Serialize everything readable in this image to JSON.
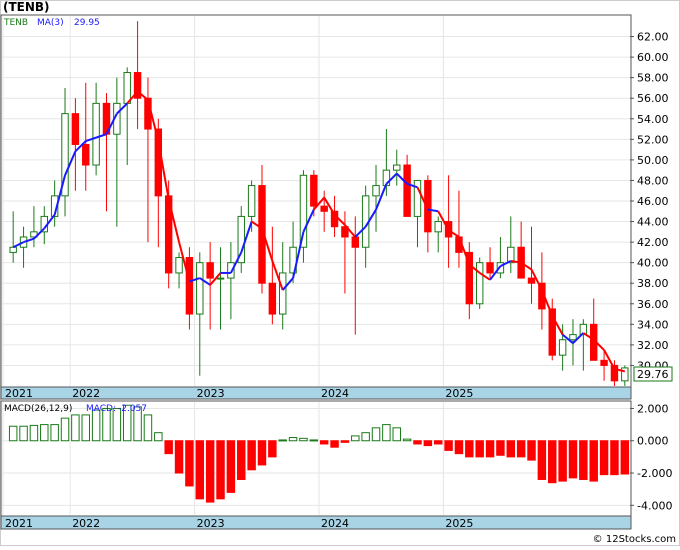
{
  "title": "(TENB)",
  "colors": {
    "up_candle": "#1a7a1a",
    "down_candle": "#ff0000",
    "ma_up": "#1a1aff",
    "ma_down": "#ff0000",
    "axis_band": "#a8d4e6",
    "last_price_box": "#1a7a1a",
    "macd_hist": "#ff0000",
    "macd_hist_pos": "#1a7a1a"
  },
  "price_panel": {
    "legend": {
      "symbol": "TENB",
      "ma_label": "MA(3)",
      "ma_value": "29.95"
    },
    "last_price": "29.76"
  },
  "macd_panel": {
    "legend": {
      "params": "MACD(26,12,9)",
      "macd_label": "MACD:",
      "macd_value": "-2.057"
    }
  },
  "x_axis_years": [
    "2021",
    "2022",
    "2023",
    "2024",
    "2025"
  ],
  "footer": "© 12Stocks.com",
  "chart_data": [
    {
      "type": "candlestick",
      "title": "(TENB)",
      "ylim": [
        28.0,
        64.0
      ],
      "y_ticks": [
        "30.00",
        "32.00",
        "34.00",
        "36.00",
        "38.00",
        "40.00",
        "42.00",
        "44.00",
        "46.00",
        "48.00",
        "50.00",
        "52.00",
        "54.00",
        "56.00",
        "58.00",
        "60.00",
        "62.00"
      ],
      "y_tick_values": [
        30,
        32,
        34,
        36,
        38,
        40,
        42,
        44,
        46,
        48,
        50,
        52,
        54,
        56,
        58,
        60,
        62
      ],
      "ohlc": [
        [
          41.0,
          45.0,
          40.0,
          41.5
        ],
        [
          41.5,
          43.5,
          39.5,
          42.5
        ],
        [
          42.5,
          45.5,
          41.5,
          43.0
        ],
        [
          43.0,
          45.5,
          41.8,
          44.5
        ],
        [
          44.5,
          48.0,
          43.5,
          46.5
        ],
        [
          46.5,
          57.0,
          44.5,
          54.5
        ],
        [
          54.5,
          56.0,
          47.0,
          51.5
        ],
        [
          51.5,
          57.5,
          47.0,
          49.5
        ],
        [
          49.5,
          57.5,
          48.5,
          55.5
        ],
        [
          55.5,
          56.5,
          45.0,
          52.5
        ],
        [
          52.5,
          58.0,
          43.5,
          55.5
        ],
        [
          55.5,
          59.0,
          49.5,
          58.5
        ],
        [
          58.5,
          63.5,
          53.0,
          56.0
        ],
        [
          56.0,
          58.0,
          42.0,
          53.0
        ],
        [
          53.0,
          54.0,
          41.5,
          46.5
        ],
        [
          46.5,
          48.0,
          37.5,
          39.0
        ],
        [
          39.0,
          41.0,
          37.5,
          40.5
        ],
        [
          40.5,
          41.5,
          33.5,
          35.0
        ],
        [
          35.0,
          41.0,
          29.0,
          40.0
        ],
        [
          40.0,
          42.0,
          33.5,
          38.5
        ],
        [
          38.5,
          41.5,
          33.5,
          38.5
        ],
        [
          38.5,
          42.0,
          34.5,
          40.0
        ],
        [
          40.0,
          45.5,
          39.0,
          44.5
        ],
        [
          44.5,
          48.0,
          43.0,
          47.5
        ],
        [
          47.5,
          49.5,
          37.0,
          38.0
        ],
        [
          38.0,
          43.5,
          34.0,
          35.0
        ],
        [
          35.0,
          42.0,
          33.5,
          39.0
        ],
        [
          39.0,
          44.0,
          38.0,
          41.5
        ],
        [
          41.5,
          49.0,
          40.0,
          48.5
        ],
        [
          48.5,
          49.0,
          44.5,
          45.5
        ],
        [
          45.5,
          47.0,
          43.0,
          45.0
        ],
        [
          45.0,
          46.5,
          42.5,
          43.5
        ],
        [
          43.5,
          45.0,
          37.0,
          42.5
        ],
        [
          42.5,
          44.5,
          33.0,
          41.5
        ],
        [
          41.5,
          47.5,
          39.5,
          46.5
        ],
        [
          46.5,
          49.5,
          43.0,
          47.5
        ],
        [
          47.5,
          53.0,
          46.5,
          49.0
        ],
        [
          49.0,
          51.0,
          47.5,
          49.5
        ],
        [
          49.5,
          50.5,
          45.0,
          44.5
        ],
        [
          44.5,
          47.0,
          41.5,
          48.0
        ],
        [
          48.0,
          48.5,
          41.0,
          43.0
        ],
        [
          43.0,
          44.5,
          41.0,
          44.0
        ],
        [
          44.0,
          48.5,
          39.5,
          42.5
        ],
        [
          42.5,
          47.0,
          39.5,
          41.0
        ],
        [
          41.0,
          42.0,
          34.5,
          36.0
        ],
        [
          36.0,
          40.5,
          35.5,
          40.0
        ],
        [
          40.0,
          41.5,
          38.5,
          39.0
        ],
        [
          39.0,
          42.5,
          38.5,
          40.0
        ],
        [
          40.0,
          44.5,
          39.0,
          41.5
        ],
        [
          41.5,
          44.0,
          38.5,
          38.5
        ],
        [
          38.5,
          43.5,
          36.0,
          38.0
        ],
        [
          38.0,
          41.0,
          33.5,
          35.5
        ],
        [
          35.5,
          36.5,
          30.5,
          31.0
        ],
        [
          31.0,
          34.0,
          29.5,
          32.5
        ],
        [
          32.5,
          34.5,
          30.0,
          33.0
        ],
        [
          33.0,
          34.5,
          29.5,
          34.0
        ],
        [
          34.0,
          36.5,
          31.0,
          30.5
        ],
        [
          30.5,
          31.5,
          28.5,
          30.0
        ],
        [
          30.0,
          30.5,
          28.0,
          28.5
        ],
        [
          28.5,
          30.0,
          28.0,
          29.76
        ]
      ],
      "ma_color_index": [
        1,
        1,
        1,
        1,
        1,
        1,
        1,
        1,
        1,
        1,
        1,
        1,
        0,
        0,
        0,
        0,
        0,
        0,
        1,
        1,
        0,
        1,
        1,
        1,
        0,
        0,
        0,
        1,
        1,
        1,
        0,
        0,
        0,
        0,
        1,
        1,
        1,
        1,
        1,
        1,
        0,
        1,
        0,
        0,
        0,
        0,
        0,
        1,
        1,
        0,
        0,
        0,
        0,
        0,
        1,
        1,
        0,
        0,
        0,
        0
      ]
    },
    {
      "type": "bar",
      "title": "MACD(26,12,9)",
      "ylim": [
        -4.6,
        2.4
      ],
      "y_ticks": [
        "2.000",
        "0.000",
        "-2.000",
        "-4.000"
      ],
      "y_tick_values": [
        2,
        0,
        -2,
        -4
      ],
      "values": [
        0.9,
        0.9,
        0.95,
        1.0,
        1.0,
        1.4,
        1.6,
        1.6,
        1.9,
        2.0,
        2.0,
        2.2,
        2.1,
        1.6,
        0.5,
        -0.8,
        -2.0,
        -2.8,
        -3.6,
        -3.8,
        -3.6,
        -3.2,
        -2.4,
        -1.8,
        -1.5,
        -1.0,
        0.05,
        0.2,
        0.15,
        0.05,
        -0.2,
        -0.4,
        -0.1,
        0.3,
        0.5,
        0.8,
        1.0,
        0.8,
        0.1,
        -0.2,
        -0.3,
        -0.2,
        -0.6,
        -0.8,
        -1.0,
        -1.0,
        -1.0,
        -0.9,
        -1.0,
        -1.0,
        -1.2,
        -2.4,
        -2.6,
        -2.5,
        -2.3,
        -2.4,
        -2.5,
        -2.1,
        -2.1,
        -2.06
      ]
    }
  ]
}
